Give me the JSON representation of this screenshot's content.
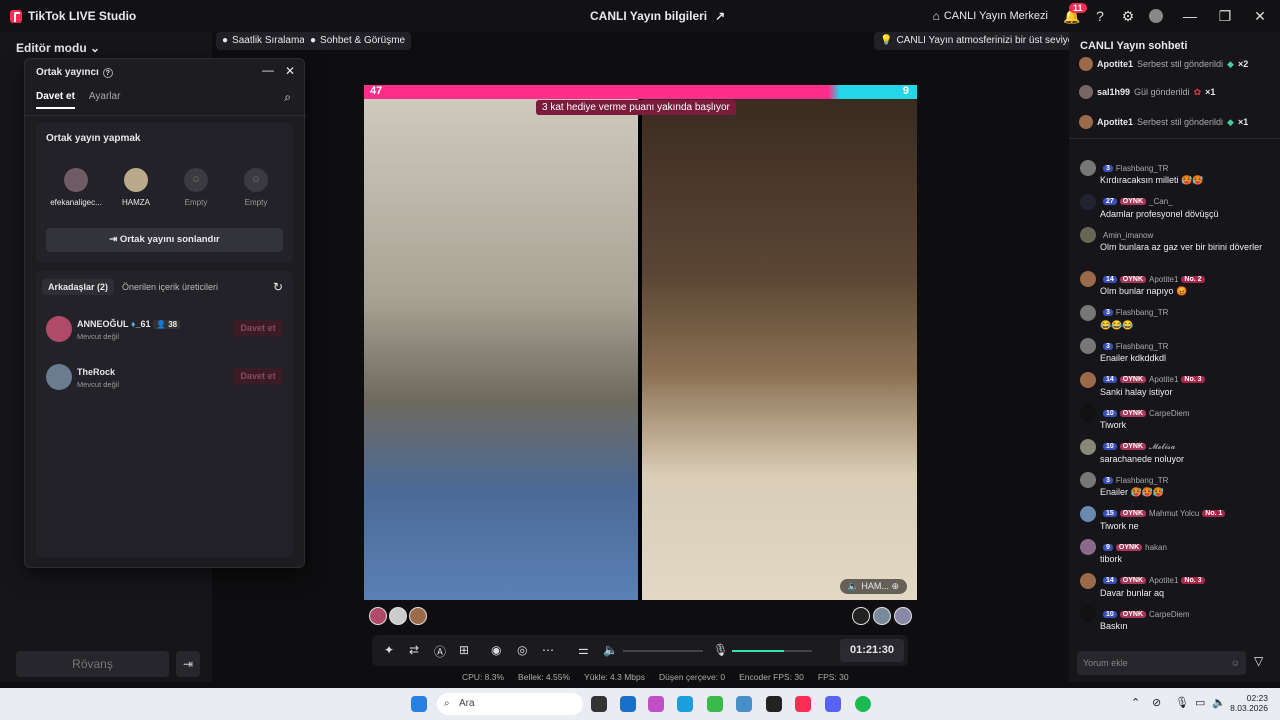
{
  "app": {
    "name": "TikTok LIVE Studio",
    "center_title": "CANLI Yayın bilgileri",
    "live_center": "CANLI Yayın Merkezi",
    "notif_count": "11"
  },
  "left": {
    "editor_mode": "Editör modu",
    "rematch": "Rövanş"
  },
  "chips": {
    "hourly_rank": "Saatlik Sıralama",
    "chat_meet": "Sohbet & Görüşme",
    "tip": "CANLI Yayın atmosferinizi bir üst seviyeye ..."
  },
  "popup": {
    "title": "Ortak yayıncı",
    "tab_invite": "Davet et",
    "tab_settings": "Ayarlar",
    "section_title": "Ortak yayın yapmak",
    "slots": [
      {
        "name": "efekanaligec...",
        "color": "#6e5b66"
      },
      {
        "name": "HAMZA",
        "color": "#b7a98a"
      },
      {
        "name": "Empty",
        "color": "#3a3a40"
      },
      {
        "name": "Empty",
        "color": "#3a3a40"
      }
    ],
    "end_button": "Ortak yayını sonlandır",
    "friends_tab": "Arkadaşlar (2)",
    "suggested_tab": "Önerilen içerik üreticileri",
    "friends": [
      {
        "name": "ANNEOĞUL",
        "tag": "_61",
        "count": "38",
        "status": "Mevcut değil",
        "invite": "Davet et",
        "color": "#b04a6a"
      },
      {
        "name": "TheRock",
        "tag": "",
        "count": "",
        "status": "Mevcut değil",
        "invite": "Davet et",
        "color": "#6a7c90"
      }
    ]
  },
  "video": {
    "score_left": "47",
    "score_right": "9",
    "banner": "3 kat hediye verme puanı yakında başlıyor",
    "cohost_label": "HAM..."
  },
  "toolbar": {
    "timer": "01:21:30",
    "mic_level": 0.65
  },
  "stats": {
    "cpu": "CPU: 8.3%",
    "mem": "Bellek: 4.55%",
    "upload": "Yükle: 4.3 Mbps",
    "dropped": "Düşen çerçeve: 0",
    "encoder_fps": "Encoder FPS: 30",
    "fps": "FPS: 30"
  },
  "chat": {
    "title": "CANLI Yayın sohbeti",
    "gifts": [
      {
        "user": "Apotite1",
        "text": "Serbest stil gönderildi",
        "mult": "×2"
      },
      {
        "user": "sal1h99",
        "text": "Gül gönderildi",
        "mult": "×1"
      },
      {
        "user": "Apotite1",
        "text": "Serbest stil gönderildi",
        "mult": "×1"
      }
    ],
    "messages": [
      {
        "lvl": "3",
        "oynk": "",
        "user": "Flashbang_TR",
        "rank": "",
        "text": "Kırdıracaksın milleti 🥵🥵",
        "color": "#777"
      },
      {
        "lvl": "27",
        "oynk": "OYNK",
        "user": "_Can_",
        "rank": "",
        "text": "Adamlar profesyonel dövüşçü",
        "color": "#223"
      },
      {
        "lvl": "",
        "oynk": "",
        "user": "Amin_imanow",
        "rank": "",
        "text": "Olm bunlara az gaz ver bir birini döverler",
        "color": "#665"
      },
      {
        "lvl": "14",
        "oynk": "OYNK",
        "user": "Apotite1",
        "rank": "No. 2",
        "text": "Olm bunlar napıyo 😡",
        "color": "#9a6a4a"
      },
      {
        "lvl": "3",
        "oynk": "",
        "user": "Flashbang_TR",
        "rank": "",
        "text": "😂😂😂",
        "color": "#777"
      },
      {
        "lvl": "3",
        "oynk": "",
        "user": "Flashbang_TR",
        "rank": "",
        "text": "Enailer kdkddkdl",
        "color": "#777"
      },
      {
        "lvl": "14",
        "oynk": "OYNK",
        "user": "Apotite1",
        "rank": "No. 3",
        "text": "Sanki halay istiyor",
        "color": "#9a6a4a"
      },
      {
        "lvl": "10",
        "oynk": "OYNK",
        "user": "CarpeDiem",
        "rank": "",
        "text": "Tiwork",
        "color": "#111"
      },
      {
        "lvl": "10",
        "oynk": "OYNK",
        "user": "𝓜𝓮𝓵𝓲𝓼𝓪",
        "rank": "",
        "text": "sarachanede noluyor",
        "color": "#887"
      },
      {
        "lvl": "3",
        "oynk": "",
        "user": "Flashbang_TR",
        "rank": "",
        "text": "Enailer 🥵🥵🥵",
        "color": "#777"
      },
      {
        "lvl": "15",
        "oynk": "OYNK",
        "user": "Mahmut Yolcu",
        "rank": "No. 1",
        "text": "Tiwork ne",
        "color": "#6a8ab0"
      },
      {
        "lvl": "9",
        "oynk": "OYNK",
        "user": "hakan",
        "rank": "",
        "text": "tibork",
        "color": "#8a6a8a"
      },
      {
        "lvl": "14",
        "oynk": "OYNK",
        "user": "Apotite1",
        "rank": "No. 3",
        "text": "Davar bunlar aq",
        "color": "#9a6a4a"
      },
      {
        "lvl": "10",
        "oynk": "OYNK",
        "user": "CarpeDiem",
        "rank": "",
        "text": "Baskın",
        "color": "#111"
      }
    ],
    "input_placeholder": "Yorum ekle"
  },
  "taskbar": {
    "search": "Ara",
    "time": "02:23",
    "date": "8.03.2026"
  }
}
